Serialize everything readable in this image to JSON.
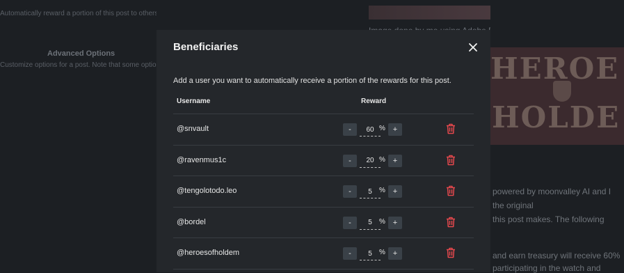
{
  "background": {
    "left_faint_lines": [
      "Automatically reward a portion of this post to others",
      "",
      "Advanced Options",
      "Customize options for a post. Note that some options are"
    ],
    "advanced_title": "Advanced Options",
    "caption": "Image done by me using Adobe Express and AI tools",
    "poster_line1": "HEROE",
    "poster_line2": "HOLDE",
    "article_lines": [
      "powered by moonvalley AI and I",
      "the original",
      "this post makes. The following",
      "and earn treasury will receive 60%",
      "participating in the watch and"
    ]
  },
  "modal": {
    "title": "Beneficiaries",
    "description": "Add a user you want to automatically receive a portion of the rewards for this post.",
    "columns": {
      "username": "Username",
      "reward": "Reward"
    },
    "minus_label": "-",
    "plus_label": "+",
    "percent_sign": "%",
    "rows": [
      {
        "username": "@snvault",
        "reward": "60"
      },
      {
        "username": "@ravenmus1c",
        "reward": "20"
      },
      {
        "username": "@tengolotodo.leo",
        "reward": "5"
      },
      {
        "username": "@bordel",
        "reward": "5"
      },
      {
        "username": "@heroesofholdem",
        "reward": "5"
      }
    ]
  },
  "colors": {
    "delete_icon": "#e5484d",
    "modal_bg": "#24272b",
    "stepper_bg": "#3a4148"
  },
  "icons": {
    "close": "close-icon",
    "delete": "trash-icon"
  }
}
